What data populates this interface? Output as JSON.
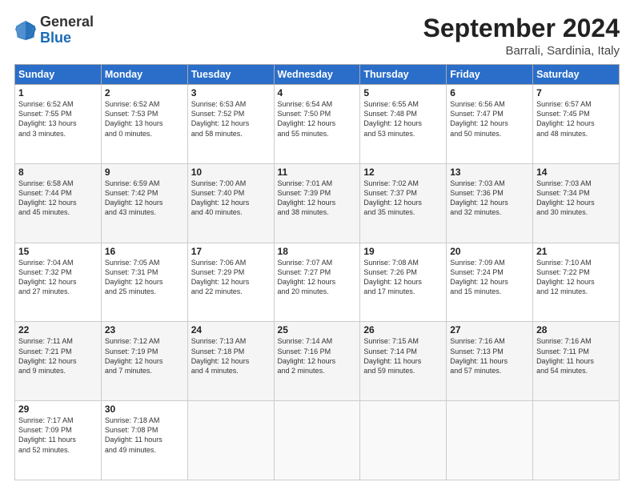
{
  "header": {
    "logo_general": "General",
    "logo_blue": "Blue",
    "month_title": "September 2024",
    "subtitle": "Barrali, Sardinia, Italy"
  },
  "days_of_week": [
    "Sunday",
    "Monday",
    "Tuesday",
    "Wednesday",
    "Thursday",
    "Friday",
    "Saturday"
  ],
  "weeks": [
    [
      {
        "num": "1",
        "info": "Sunrise: 6:52 AM\nSunset: 7:55 PM\nDaylight: 13 hours\nand 3 minutes."
      },
      {
        "num": "2",
        "info": "Sunrise: 6:52 AM\nSunset: 7:53 PM\nDaylight: 13 hours\nand 0 minutes."
      },
      {
        "num": "3",
        "info": "Sunrise: 6:53 AM\nSunset: 7:52 PM\nDaylight: 12 hours\nand 58 minutes."
      },
      {
        "num": "4",
        "info": "Sunrise: 6:54 AM\nSunset: 7:50 PM\nDaylight: 12 hours\nand 55 minutes."
      },
      {
        "num": "5",
        "info": "Sunrise: 6:55 AM\nSunset: 7:48 PM\nDaylight: 12 hours\nand 53 minutes."
      },
      {
        "num": "6",
        "info": "Sunrise: 6:56 AM\nSunset: 7:47 PM\nDaylight: 12 hours\nand 50 minutes."
      },
      {
        "num": "7",
        "info": "Sunrise: 6:57 AM\nSunset: 7:45 PM\nDaylight: 12 hours\nand 48 minutes."
      }
    ],
    [
      {
        "num": "8",
        "info": "Sunrise: 6:58 AM\nSunset: 7:44 PM\nDaylight: 12 hours\nand 45 minutes."
      },
      {
        "num": "9",
        "info": "Sunrise: 6:59 AM\nSunset: 7:42 PM\nDaylight: 12 hours\nand 43 minutes."
      },
      {
        "num": "10",
        "info": "Sunrise: 7:00 AM\nSunset: 7:40 PM\nDaylight: 12 hours\nand 40 minutes."
      },
      {
        "num": "11",
        "info": "Sunrise: 7:01 AM\nSunset: 7:39 PM\nDaylight: 12 hours\nand 38 minutes."
      },
      {
        "num": "12",
        "info": "Sunrise: 7:02 AM\nSunset: 7:37 PM\nDaylight: 12 hours\nand 35 minutes."
      },
      {
        "num": "13",
        "info": "Sunrise: 7:03 AM\nSunset: 7:36 PM\nDaylight: 12 hours\nand 32 minutes."
      },
      {
        "num": "14",
        "info": "Sunrise: 7:03 AM\nSunset: 7:34 PM\nDaylight: 12 hours\nand 30 minutes."
      }
    ],
    [
      {
        "num": "15",
        "info": "Sunrise: 7:04 AM\nSunset: 7:32 PM\nDaylight: 12 hours\nand 27 minutes."
      },
      {
        "num": "16",
        "info": "Sunrise: 7:05 AM\nSunset: 7:31 PM\nDaylight: 12 hours\nand 25 minutes."
      },
      {
        "num": "17",
        "info": "Sunrise: 7:06 AM\nSunset: 7:29 PM\nDaylight: 12 hours\nand 22 minutes."
      },
      {
        "num": "18",
        "info": "Sunrise: 7:07 AM\nSunset: 7:27 PM\nDaylight: 12 hours\nand 20 minutes."
      },
      {
        "num": "19",
        "info": "Sunrise: 7:08 AM\nSunset: 7:26 PM\nDaylight: 12 hours\nand 17 minutes."
      },
      {
        "num": "20",
        "info": "Sunrise: 7:09 AM\nSunset: 7:24 PM\nDaylight: 12 hours\nand 15 minutes."
      },
      {
        "num": "21",
        "info": "Sunrise: 7:10 AM\nSunset: 7:22 PM\nDaylight: 12 hours\nand 12 minutes."
      }
    ],
    [
      {
        "num": "22",
        "info": "Sunrise: 7:11 AM\nSunset: 7:21 PM\nDaylight: 12 hours\nand 9 minutes."
      },
      {
        "num": "23",
        "info": "Sunrise: 7:12 AM\nSunset: 7:19 PM\nDaylight: 12 hours\nand 7 minutes."
      },
      {
        "num": "24",
        "info": "Sunrise: 7:13 AM\nSunset: 7:18 PM\nDaylight: 12 hours\nand 4 minutes."
      },
      {
        "num": "25",
        "info": "Sunrise: 7:14 AM\nSunset: 7:16 PM\nDaylight: 12 hours\nand 2 minutes."
      },
      {
        "num": "26",
        "info": "Sunrise: 7:15 AM\nSunset: 7:14 PM\nDaylight: 11 hours\nand 59 minutes."
      },
      {
        "num": "27",
        "info": "Sunrise: 7:16 AM\nSunset: 7:13 PM\nDaylight: 11 hours\nand 57 minutes."
      },
      {
        "num": "28",
        "info": "Sunrise: 7:16 AM\nSunset: 7:11 PM\nDaylight: 11 hours\nand 54 minutes."
      }
    ],
    [
      {
        "num": "29",
        "info": "Sunrise: 7:17 AM\nSunset: 7:09 PM\nDaylight: 11 hours\nand 52 minutes."
      },
      {
        "num": "30",
        "info": "Sunrise: 7:18 AM\nSunset: 7:08 PM\nDaylight: 11 hours\nand 49 minutes."
      },
      {
        "num": "",
        "info": ""
      },
      {
        "num": "",
        "info": ""
      },
      {
        "num": "",
        "info": ""
      },
      {
        "num": "",
        "info": ""
      },
      {
        "num": "",
        "info": ""
      }
    ]
  ]
}
